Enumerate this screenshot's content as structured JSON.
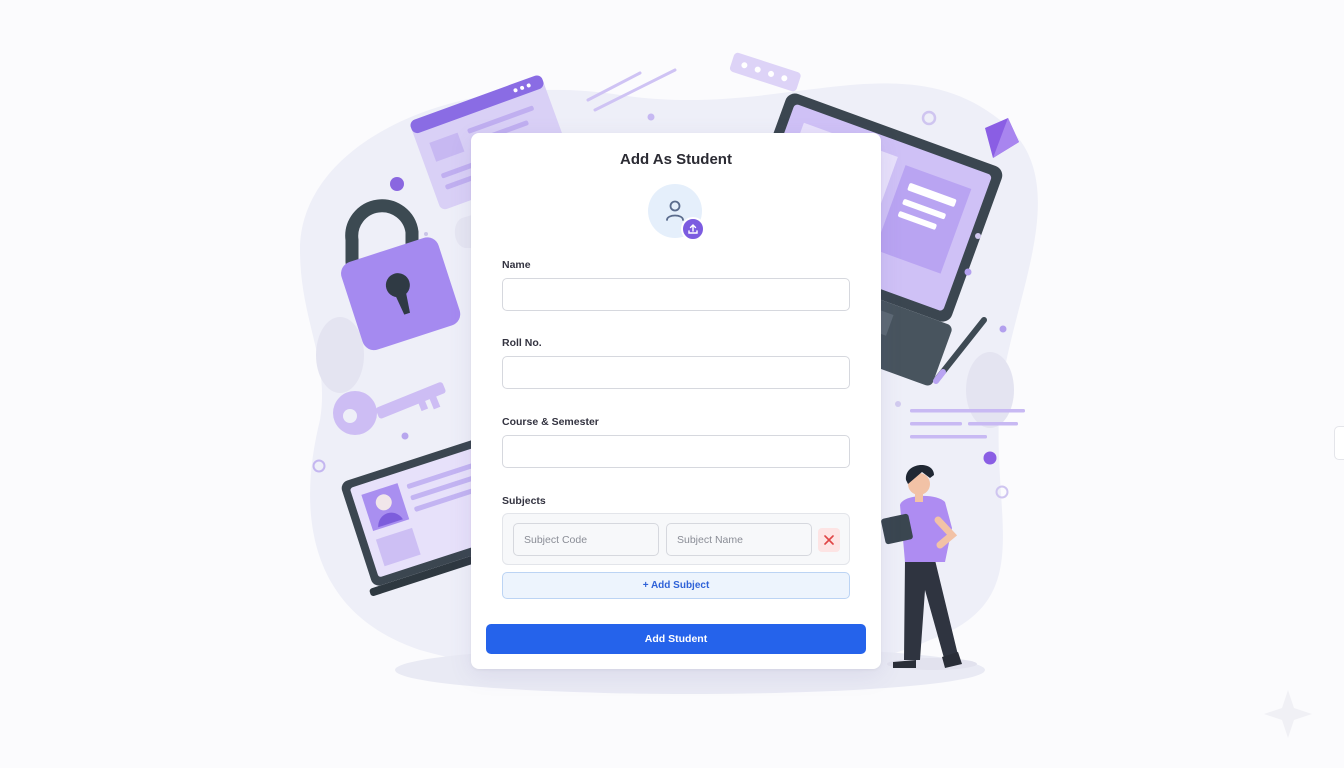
{
  "form": {
    "title": "Add As Student",
    "name_label": "Name",
    "roll_label": "Roll No.",
    "course_label": "Course & Semester",
    "subjects_label": "Subjects",
    "subject_code_placeholder": "Subject Code",
    "subject_name_placeholder": "Subject Name",
    "add_subject_label": "+ Add Subject",
    "submit_label": "Add Student"
  },
  "icons": {
    "avatar": "user-icon",
    "upload": "upload-icon",
    "remove": "close-icon"
  },
  "colors": {
    "primary": "#2563eb",
    "accent": "#7c5ce0",
    "danger": "#e04545"
  }
}
